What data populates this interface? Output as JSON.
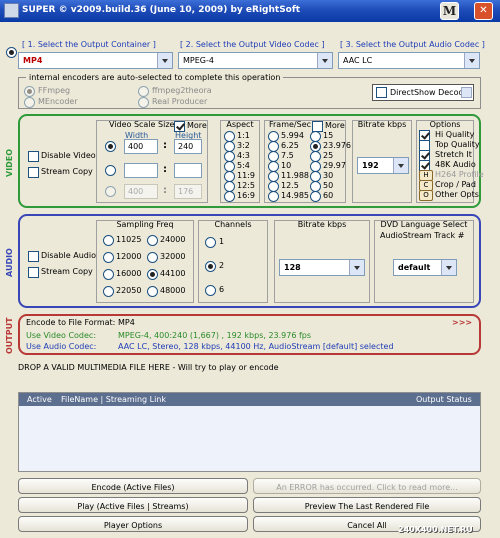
{
  "window": {
    "title": "SUPER © v2009.build.36 (June 10, 2009) by eRightSoft",
    "help_button": "M",
    "close_button": "✕"
  },
  "containers": {
    "output_container": {
      "label": "[ 1.      Select the Output Container ]",
      "value": "MP4"
    },
    "video_codec": {
      "label": "[ 2.      Select the Output Video Codec ]",
      "value": "MPEG-4"
    },
    "audio_codec": {
      "label": "[ 3.      Select the Output Audio Codec ]",
      "value": "AAC LC"
    }
  },
  "encoders": {
    "label": "internal encoders are auto-selected to complete this operation",
    "ffmpeg": "FFmpeg",
    "mencoder": "MEncoder",
    "ffmpeg2theora": "ffmpeg2theora",
    "real_producer": "Real Producer",
    "directshow": "DirectShow Decode"
  },
  "video": {
    "side": "VIDEO",
    "disable": "Disable Video",
    "stream_copy": "Stream Copy",
    "scale": {
      "label": "Video Scale Size",
      "more": "More",
      "width_label": "Width",
      "height_label": "Height",
      "rows": [
        {
          "w": "400",
          "h": "240"
        },
        {
          "w": "",
          "h": ""
        },
        {
          "w": "400",
          "h": "176"
        }
      ]
    },
    "aspect": {
      "label": "Aspect",
      "items": [
        "1:1",
        "3:2",
        "4:3",
        "5:4",
        "11:9",
        "12:5",
        "16:9"
      ]
    },
    "fps": {
      "label": "Frame/Sec",
      "more": "More",
      "left": [
        "5.994",
        "6.25",
        "7.5",
        "10",
        "11.988",
        "12.5",
        "14.985"
      ],
      "right": [
        "15",
        "23.976",
        "25",
        "29.97",
        "30",
        "50",
        "60"
      ]
    },
    "bitrate": {
      "label": "Bitrate  kbps",
      "value": "192"
    },
    "options": {
      "label": "Options",
      "items": [
        "Hi Quality",
        "Top Quality",
        "Stretch It",
        "48K Audio",
        "H264 Profile",
        "Crop / Pad",
        "Other Opts"
      ],
      "letters": [
        "H",
        "C",
        "O"
      ]
    }
  },
  "audio": {
    "side": "AUDIO",
    "disable": "Disable Audio",
    "stream_copy": "Stream Copy",
    "sampling": {
      "label": "Sampling Freq",
      "items": [
        "11025",
        "24000",
        "12000",
        "32000",
        "16000",
        "44100",
        "22050",
        "48000"
      ]
    },
    "channels": {
      "label": "Channels",
      "items": [
        "1",
        "2",
        "6"
      ]
    },
    "bitrate": {
      "label": "Bitrate  kbps",
      "value": "128"
    },
    "dvd": {
      "label": "DVD Language Select",
      "sublabel": "AudioStream  Track #",
      "value": "default"
    }
  },
  "output": {
    "side": "OUTPUT",
    "format_label": "Encode to File Format:",
    "format_value": "MP4",
    "more": ">>>",
    "video_label": "Use Video Codec:",
    "video_value": "MPEG-4,  400:240 (1,667) ,  192 kbps,  23.976 fps",
    "audio_label": "Use Audio Codec:",
    "audio_value": "AAC LC,   Stereo,  128 kbps,   44100 Hz,   AudioStream [default] selected"
  },
  "drop": {
    "text": "DROP A VALID MULTIMEDIA FILE HERE - Will try to play or encode"
  },
  "file_table": {
    "columns": [
      "Active",
      "FileName  |  Streaming Link",
      "Output Status"
    ]
  },
  "buttons": {
    "encode": "Encode (Active Files)",
    "error": "An ERROR has occurred. Click to read more...",
    "play": "Play (Active Files | Streams)",
    "preview": "Preview The Last Rendered File",
    "player_options": "Player Options",
    "cancel": "Cancel All"
  },
  "watermark": "240X400.NET.RU"
}
